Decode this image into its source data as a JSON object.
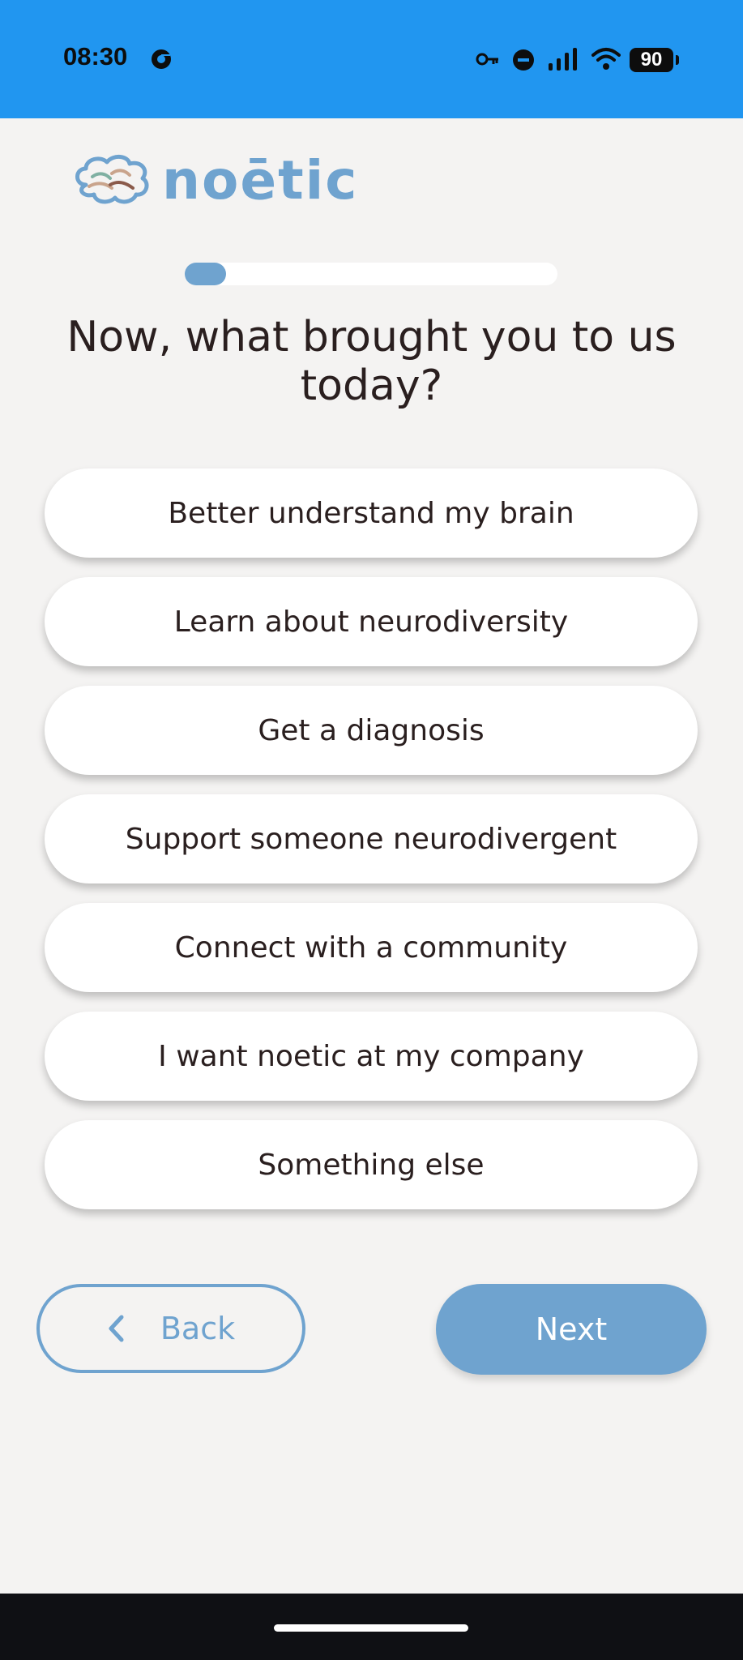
{
  "status_bar": {
    "time": "08:30",
    "battery": "90",
    "icons": [
      "chrome-icon",
      "key-icon",
      "do-not-disturb-icon",
      "signal-icon",
      "wifi-icon",
      "battery-icon"
    ],
    "background": "#2196f0"
  },
  "brand": {
    "name": "noētic",
    "accent_color": "#6fa3cf"
  },
  "progress": {
    "fraction": 0.11
  },
  "question": {
    "title": "Now, what brought you to us today?"
  },
  "options": [
    {
      "label": "Better understand my brain"
    },
    {
      "label": "Learn about neurodiversity"
    },
    {
      "label": "Get a diagnosis"
    },
    {
      "label": "Support someone neurodivergent"
    },
    {
      "label": "Connect with a community"
    },
    {
      "label": "I want noetic at my company"
    },
    {
      "label": "Something else"
    }
  ],
  "navigation": {
    "back_label": "Back",
    "next_label": "Next",
    "back_icon": "chevron-left-icon"
  }
}
